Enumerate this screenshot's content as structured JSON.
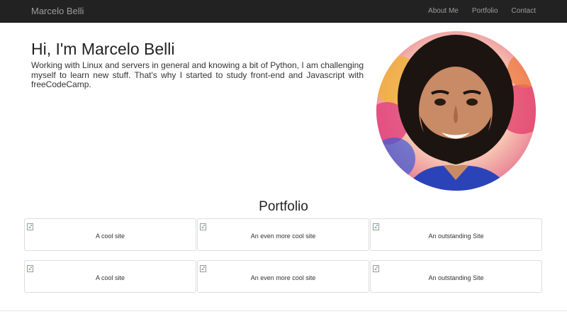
{
  "navbar": {
    "brand": "Marcelo Belli",
    "links": [
      "About Me",
      "Portfolio",
      "Contact"
    ]
  },
  "intro": {
    "title": "Hi, I'm Marcelo Belli",
    "text": "Working with Linux and servers in general and knowing a bit of Python, I am challenging myself to learn new stuff. That's why I started to study front-end and Javascript with freeCodeCamp."
  },
  "portfolio": {
    "title": "Portfolio",
    "rows": [
      [
        "A cool site",
        "An even more cool site",
        "An outstanding Site"
      ],
      [
        "A cool site",
        "An even more cool site",
        "An outstanding Site"
      ]
    ]
  },
  "colors": {
    "navbar_bg": "#222222",
    "nav_text": "#9d9d9d",
    "card_border": "#dddddd"
  }
}
